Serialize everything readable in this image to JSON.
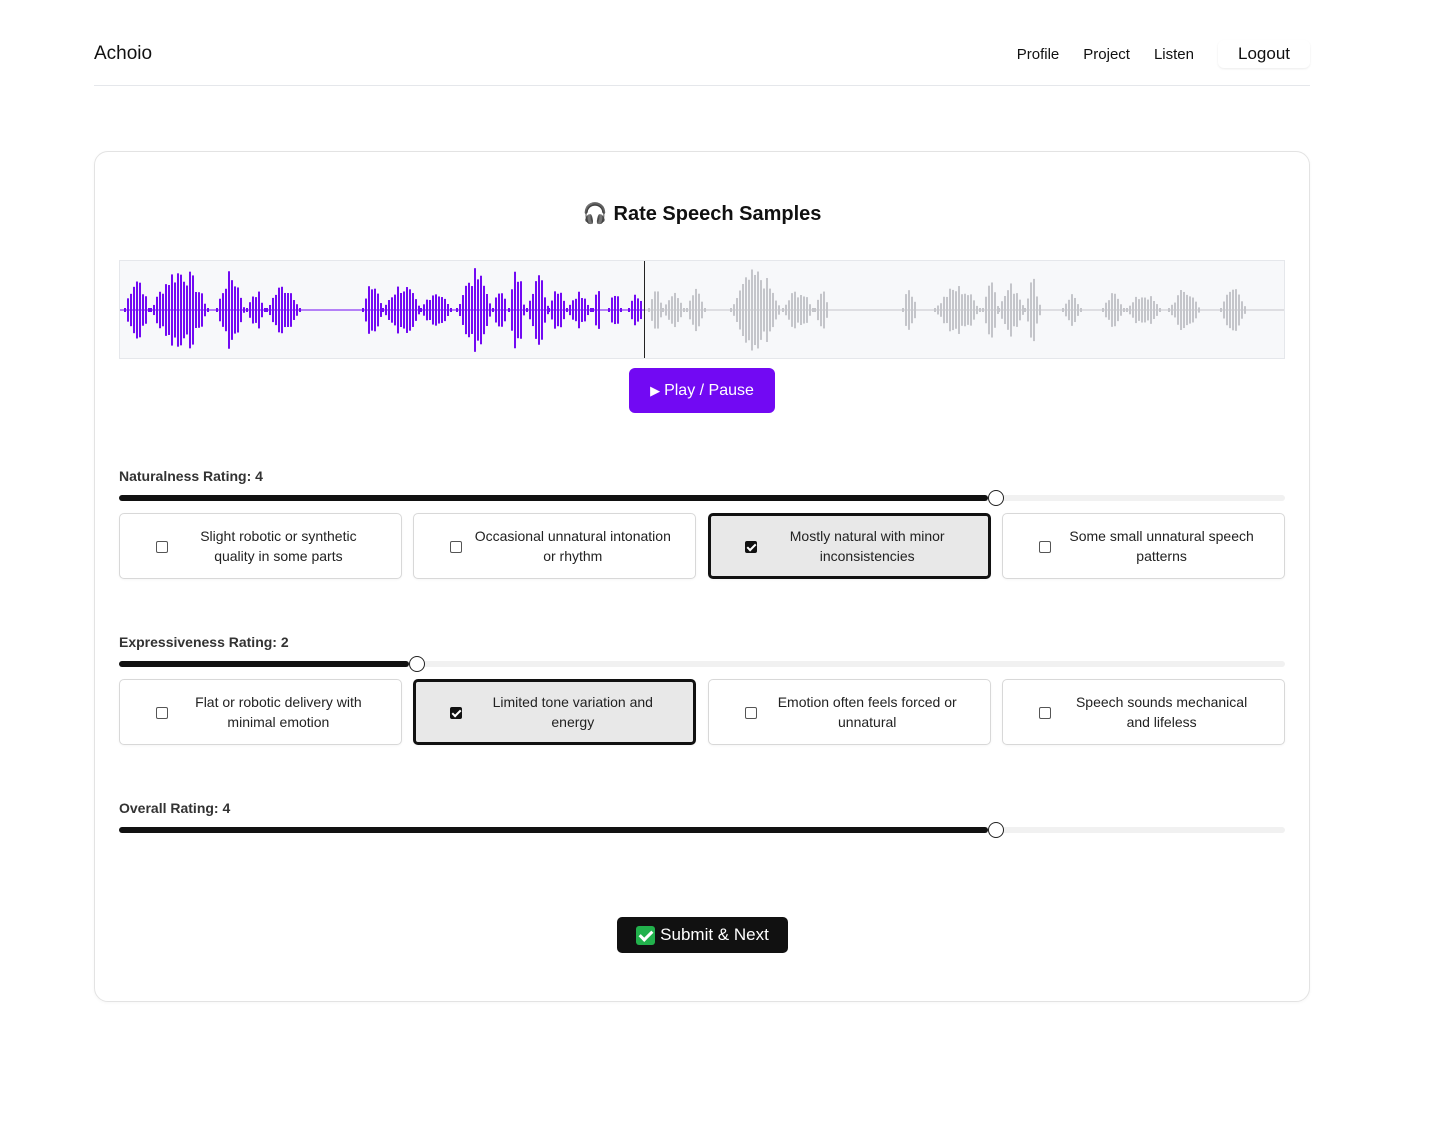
{
  "header": {
    "brand": "Achoio",
    "nav": [
      "Profile",
      "Project",
      "Listen"
    ],
    "logout_label": "Logout"
  },
  "card": {
    "title_icon": "🎧",
    "title": "Rate Speech Samples",
    "play_label": "Play / Pause",
    "play_icon": "▶",
    "playback_progress": 0.45,
    "colors": {
      "played": "#7209f3",
      "unplayed": "#c4c5ca",
      "play_button": "#7209f3",
      "submit_button": "#111111"
    },
    "naturalness": {
      "label": "Naturalness Rating: 4",
      "value": 4,
      "max": 5,
      "options": [
        {
          "text": "Slight robotic or synthetic quality in some parts",
          "checked": false
        },
        {
          "text": "Occasional unnatural intonation or rhythm",
          "checked": false
        },
        {
          "text": "Mostly natural with minor inconsistencies",
          "checked": true
        },
        {
          "text": "Some small unnatural speech patterns",
          "checked": false
        }
      ]
    },
    "expressiveness": {
      "label": "Expressiveness Rating: 2",
      "value": 2,
      "max": 5,
      "options": [
        {
          "text": "Flat or robotic delivery with minimal emotion",
          "checked": false
        },
        {
          "text": "Limited tone variation and energy",
          "checked": true
        },
        {
          "text": "Emotion often feels forced or unnatural",
          "checked": false
        },
        {
          "text": "Speech sounds mechanical and lifeless",
          "checked": false
        }
      ]
    },
    "overall": {
      "label": "Overall Rating: 4",
      "value": 4,
      "max": 5
    },
    "submit_label": "Submit & Next"
  }
}
